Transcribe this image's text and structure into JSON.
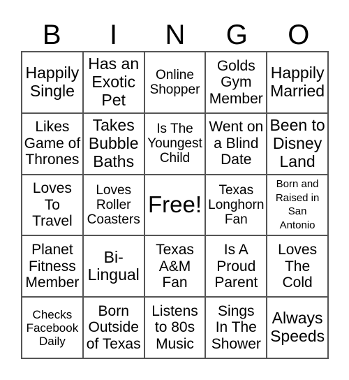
{
  "header": [
    "B",
    "I",
    "N",
    "G",
    "O"
  ],
  "cells": [
    [
      "Happily\nSingle",
      "Has an\nExotic\nPet",
      "Online\nShopper",
      "Golds\nGym\nMember",
      "Happily\nMarried"
    ],
    [
      "Likes\nGame of\nThrones",
      "Takes\nBubble\nBaths",
      "Is The\nYoungest\nChild",
      "Went on\na Blind\nDate",
      "Been to\nDisney\nLand"
    ],
    [
      "Loves\nTo\nTravel",
      "Loves\nRoller\nCoasters",
      "Free!",
      "Texas\nLonghorn\nFan",
      "Born and\nRaised in\nSan\nAntonio"
    ],
    [
      "Planet\nFitness\nMember",
      "Bi-\nLingual",
      "Texas\nA&M\nFan",
      "Is A\nProud\nParent",
      "Loves\nThe\nCold"
    ],
    [
      "Checks\nFacebook\nDaily",
      "Born\nOutside\nof Texas",
      "Listens\nto 80s\nMusic",
      "Sings\nIn The\nShower",
      "Always\nSpeeds"
    ]
  ]
}
